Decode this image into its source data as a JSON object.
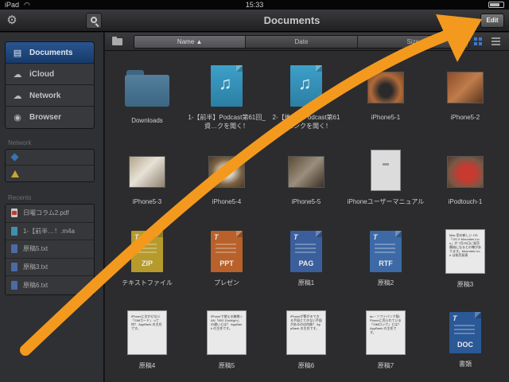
{
  "status_bar": {
    "time": "15:33",
    "carrier": "iPad"
  },
  "toolbar": {
    "title": "Documents",
    "edit_label": "Edit"
  },
  "sidebar": {
    "items": [
      {
        "label": "Documents",
        "icon": "documents-icon",
        "active": true
      },
      {
        "label": "iCloud",
        "icon": "cloud-icon"
      },
      {
        "label": "Network",
        "icon": "network-icon"
      },
      {
        "label": "Browser",
        "icon": "compass-icon"
      }
    ],
    "network_label": "Network",
    "network_items": [
      {
        "icon": "dropbox-icon"
      },
      {
        "icon": "google-drive-icon"
      }
    ],
    "recents_label": "Recents",
    "recents": [
      {
        "label": "日曜コラム2.pdf",
        "type": "pdf"
      },
      {
        "label": "1-【前半…！.m4a",
        "type": "m4a"
      },
      {
        "label": "原稿5.txt",
        "type": "txt"
      },
      {
        "label": "原稿3.txt",
        "type": "txt"
      },
      {
        "label": "原稿6.txt",
        "type": "txt"
      }
    ]
  },
  "sort": {
    "columns": [
      {
        "label": "Name ▲",
        "active": true
      },
      {
        "label": "Date",
        "active": false
      },
      {
        "label": "Size",
        "active": false
      }
    ]
  },
  "files": [
    {
      "name": "Downloads",
      "kind": "folder"
    },
    {
      "name": "1-【前半】Podcast第61回_資…クを聞く！",
      "kind": "audio"
    },
    {
      "name": "2-【後半】Podcast第61回…ンクを聞く！",
      "kind": "audio"
    },
    {
      "name": "iPhone5-1",
      "kind": "photo",
      "style": "p1"
    },
    {
      "name": "iPhone5-2",
      "kind": "photo",
      "style": "p2"
    },
    {
      "name": "iPhone5-3",
      "kind": "photo",
      "style": "p3"
    },
    {
      "name": "iPhone5-4",
      "kind": "photo",
      "style": "p4"
    },
    {
      "name": "iPhone5-5",
      "kind": "photo",
      "style": "p5"
    },
    {
      "name": "iPhoneユーザーマニュアル",
      "kind": "phonedoc"
    },
    {
      "name": "iPodtouch-1",
      "kind": "photo",
      "style": "p6"
    },
    {
      "name": "テキストファイル",
      "kind": "ext",
      "ext": "ZIP",
      "style": "zip"
    },
    {
      "name": "プレゼン",
      "kind": "ext",
      "ext": "PPT",
      "style": "ppt"
    },
    {
      "name": "原稿1",
      "kind": "ext",
      "ext": "PAG",
      "style": "pag"
    },
    {
      "name": "原稿2",
      "kind": "ext",
      "ext": "RTF",
      "style": "rtf"
    },
    {
      "name": "原稿3",
      "kind": "text",
      "preview": "Mac 用の新しい OS「OS X Mountain Lion」が 7月25日に発売開始になるとの噂があります。Mountain Lion は発売発表"
    },
    {
      "name": "原稿4",
      "kind": "text",
      "preview": "iPhoneに欠かせない「SIMカード」って何？ AppBank の主任です。"
    },
    {
      "name": "原稿5",
      "kind": "text",
      "preview": "iPhoneで使える無線 LAN「802.11a/b/g/n」の違いとは？ AppBank の主任です。"
    },
    {
      "name": "原稿6",
      "kind": "text",
      "preview": "iPhoneが繋がるできる手段とできない手段があるのは何故？ AppBank の主任です。"
    },
    {
      "name": "原稿7",
      "kind": "text",
      "preview": "au・ソフトバンク版iPhoneに売られている「SIMロック」とは？ AppBank の主任です。"
    },
    {
      "name": "書類",
      "kind": "ext",
      "ext": "DOC",
      "style": "docx"
    }
  ],
  "colors": {
    "accent_arrow": "#f39a1e",
    "active_blue": "#2a5590"
  }
}
